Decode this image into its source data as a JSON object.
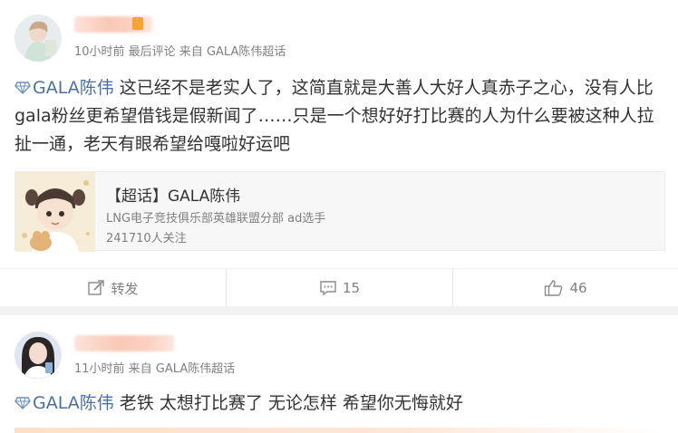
{
  "posts": [
    {
      "meta": "10小时前  最后评论  来自 GALA陈伟超话",
      "topic_tag": "GALA陈伟",
      "text": " 这已经不是老实人了，这简直就是大善人大好人真赤子之心，没有人比gala粉丝更希望借钱是假新闻了……只是一个想好好打比赛的人为什么要被这种人拉扯一通，老天有眼希望给嘎啦好运吧",
      "topic_card": {
        "title": "【超话】GALA陈伟",
        "description": "LNG电子竞技俱乐部英雄联盟分部 ad选手",
        "followers": "241710人关注"
      },
      "actions": {
        "repost": "转发",
        "comments": "15",
        "likes": "46"
      }
    },
    {
      "meta": "11小时前  来自 GALA陈伟超话",
      "topic_tag": "GALA陈伟",
      "text": " 老铁 太想打比赛了 无论怎样 希望你无悔就好"
    }
  ],
  "colors": {
    "link": "#4a6fa5",
    "muted": "#808080",
    "background": "#f2f2f2"
  },
  "icons": [
    "diamond-icon",
    "edit-repost-icon",
    "comment-icon",
    "thumbs-up-icon"
  ]
}
